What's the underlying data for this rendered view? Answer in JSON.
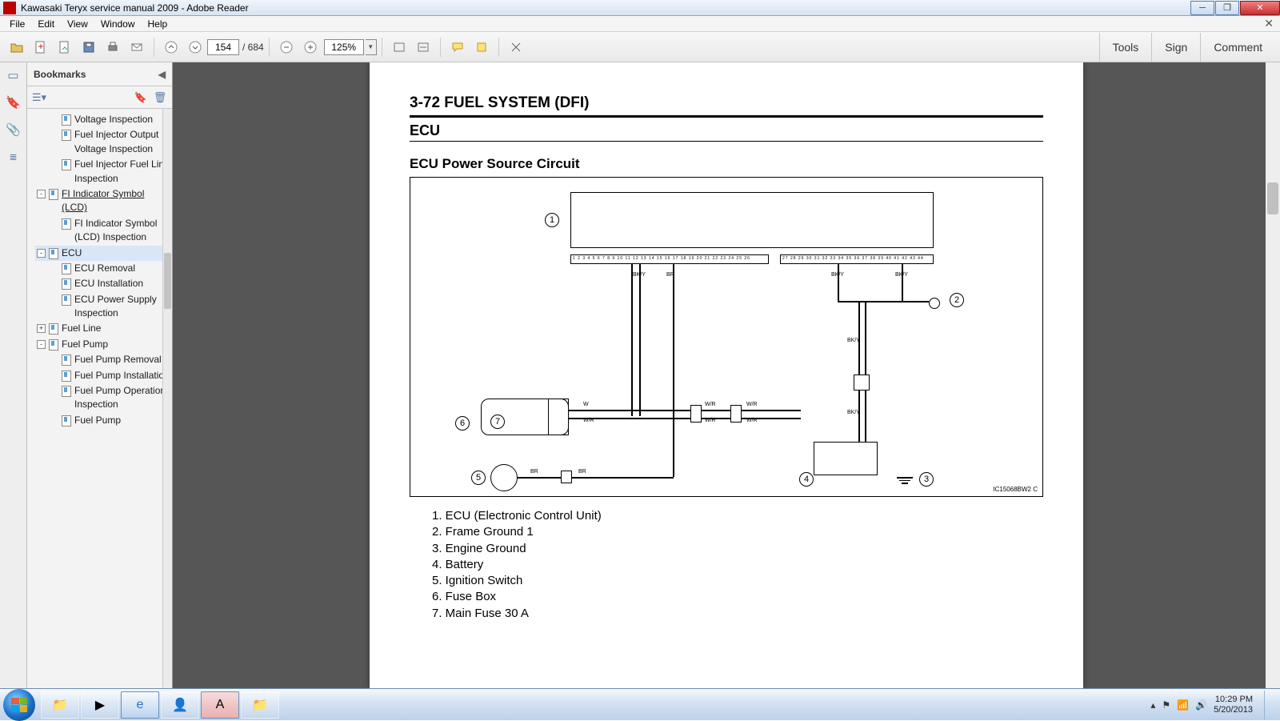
{
  "window": {
    "title": "Kawasaki Teryx service manual 2009 - Adobe Reader"
  },
  "menu": {
    "items": [
      "File",
      "Edit",
      "View",
      "Window",
      "Help"
    ]
  },
  "toolbar": {
    "page_current": "154",
    "page_total": "/ 684",
    "zoom": "125%",
    "right_tabs": [
      "Tools",
      "Sign",
      "Comment"
    ]
  },
  "bookmarks": {
    "title": "Bookmarks",
    "items": [
      {
        "depth": 3,
        "tgl": "",
        "label": "Voltage Inspection"
      },
      {
        "depth": 3,
        "tgl": "",
        "label": "Fuel Injector Output Voltage Inspection"
      },
      {
        "depth": 3,
        "tgl": "",
        "label": "Fuel Injector Fuel Line Inspection"
      },
      {
        "depth": 2,
        "tgl": "-",
        "label": "FI Indicator Symbol (LCD)",
        "u": true
      },
      {
        "depth": 3,
        "tgl": "",
        "label": "FI Indicator Symbol (LCD) Inspection"
      },
      {
        "depth": 2,
        "tgl": "-",
        "label": "ECU",
        "sel": true
      },
      {
        "depth": 3,
        "tgl": "",
        "label": "ECU Removal"
      },
      {
        "depth": 3,
        "tgl": "",
        "label": "ECU Installation"
      },
      {
        "depth": 3,
        "tgl": "",
        "label": "ECU Power Supply Inspection"
      },
      {
        "depth": 2,
        "tgl": "+",
        "label": "Fuel Line"
      },
      {
        "depth": 2,
        "tgl": "-",
        "label": "Fuel Pump"
      },
      {
        "depth": 3,
        "tgl": "",
        "label": "Fuel Pump Removal"
      },
      {
        "depth": 3,
        "tgl": "",
        "label": "Fuel Pump Installation"
      },
      {
        "depth": 3,
        "tgl": "",
        "label": "Fuel Pump Operation Inspection"
      },
      {
        "depth": 3,
        "tgl": "",
        "label": "Fuel Pump"
      }
    ]
  },
  "document": {
    "header": "3-72 FUEL SYSTEM (DFI)",
    "section": "ECU",
    "subsection": "ECU Power Source Circuit",
    "diagram_code": "IC15068BW2  C",
    "legend": [
      "1. ECU (Electronic Control Unit)",
      "2. Frame Ground 1",
      "3. Engine Ground",
      "4. Battery",
      "5. Ignition Switch",
      "6. Fuse Box",
      "7. Main Fuse 30 A"
    ],
    "pins_a": "1  2  3  4  5  6  7  8  9  10 11 12 13 14 15 16 17 18 19 20 21 22 23 24 25 26",
    "pins_b": "27 28 29 30 31 32 33 34 35 36 37 38 39 40 41 42 43 44",
    "wire_labels": {
      "bky": "BK/Y",
      "br": "BR",
      "wr": "W/R",
      "w": "W"
    }
  },
  "tray": {
    "time": "10:29 PM",
    "date": "5/20/2013"
  }
}
